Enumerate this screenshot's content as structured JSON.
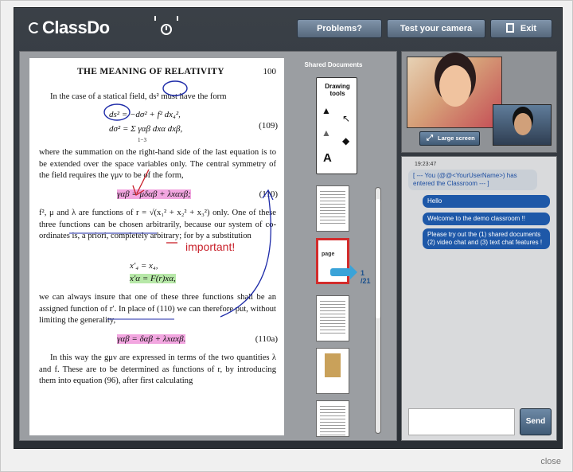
{
  "header": {
    "logo": "ClassDo",
    "problems_label": "Problems?",
    "camera_label": "Test your camera",
    "exit_label": "Exit"
  },
  "document": {
    "title": "THE MEANING OF RELATIVITY",
    "page_number": "100",
    "p1": "In the case of a statical field, ds² must have the form",
    "eq109a": "ds² = −dσ² + f² dx₄²,",
    "eq109b": "dσ² = Σ γαβ dxα dxβ,",
    "eq109_sum": "1−3",
    "eq109_num": "(109)",
    "p2": "where the summation on the right-hand side of the last equation is to be extended over the space variables only. The central symmetry of the field requires the γμν to be of the form,",
    "eq110": "γαβ = μδαβ + λxαxβ;",
    "eq110_num": "(110)",
    "p3": "f², μ and λ are functions of r = √(x₁² + x₂² + x₃²) only. One of these three functions can be chosen arbitrarily, because our system of co-ordinates is, a priori, completely arbitrary; for by a substitution",
    "annotation": "important!",
    "eq_sub1": "x′₄ = x₄,",
    "eq_sub2": "x′α = F(r)xα,",
    "p4": "we can always insure that one of these three functions shall be an assigned function of r′. In place of (110) we can therefore put, without limiting the generality,",
    "eq110a": "γαβ = δαβ + λxαxβ.",
    "eq110a_num": "(110a)",
    "p5": "In this way the gμν are expressed in terms of the two quantities λ and f. These are to be determined as functions of r, by introducing them into equation (96), after first calculating"
  },
  "shared": {
    "title": "Shared Documents",
    "tools_title_1": "Drawing",
    "tools_title_2": "tools",
    "pager_current": "1",
    "pager_total": "/21",
    "selected_thumb_label": "page"
  },
  "video": {
    "large_screen_label": "Large screen"
  },
  "chat": {
    "time": "19:23:47",
    "messages": [
      "[ --- You (@@<YourUserName>) has entered the Classroom --- ]",
      "Hello",
      "Welcome to the demo classroom !!",
      "Please try out the (1) shared documents (2) video chat and (3) text chat features !"
    ],
    "send_label": "Send"
  },
  "footer": {
    "close_label": "close"
  }
}
